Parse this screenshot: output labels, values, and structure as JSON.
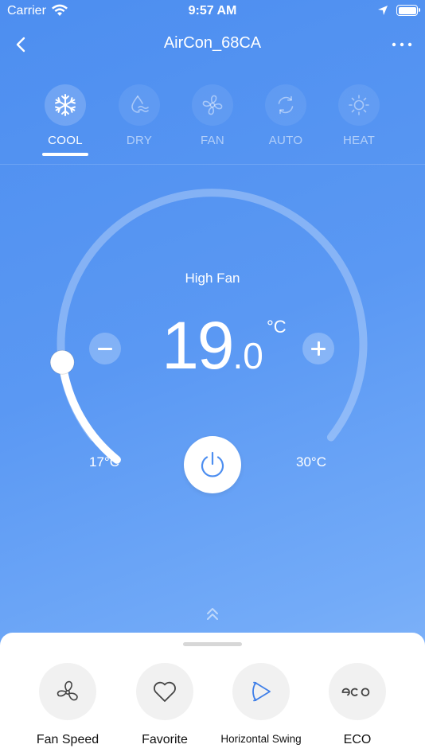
{
  "status_bar": {
    "carrier": "Carrier",
    "time": "9:57 AM"
  },
  "header": {
    "title": "AirCon_68CA"
  },
  "modes": [
    {
      "label": "COOL",
      "icon": "snowflake-icon",
      "active": true
    },
    {
      "label": "DRY",
      "icon": "droplet-icon",
      "active": false
    },
    {
      "label": "FAN",
      "icon": "fan-icon",
      "active": false
    },
    {
      "label": "AUTO",
      "icon": "cycle-arrows-icon",
      "active": false
    },
    {
      "label": "HEAT",
      "icon": "sun-icon",
      "active": false
    }
  ],
  "thermostat": {
    "fan_status": "High Fan",
    "temp_whole": "19",
    "temp_decimal": ".0",
    "unit": "°C",
    "min_label": "17°C",
    "max_label": "30°C",
    "min_value": 17,
    "max_value": 30,
    "setpoint": 19.0
  },
  "functions": [
    {
      "label": "Fan Speed",
      "icon": "fan-speed-icon"
    },
    {
      "label": "Favorite",
      "icon": "heart-icon"
    },
    {
      "label": "Horizontal Swing",
      "icon": "horizontal-swing-icon"
    },
    {
      "label": "ECO",
      "icon": "eco-icon"
    }
  ],
  "colors": {
    "accent": "#4d8ef0",
    "swing_icon": "#3f7fe8",
    "sheet_button_bg": "#f1f1f1"
  }
}
